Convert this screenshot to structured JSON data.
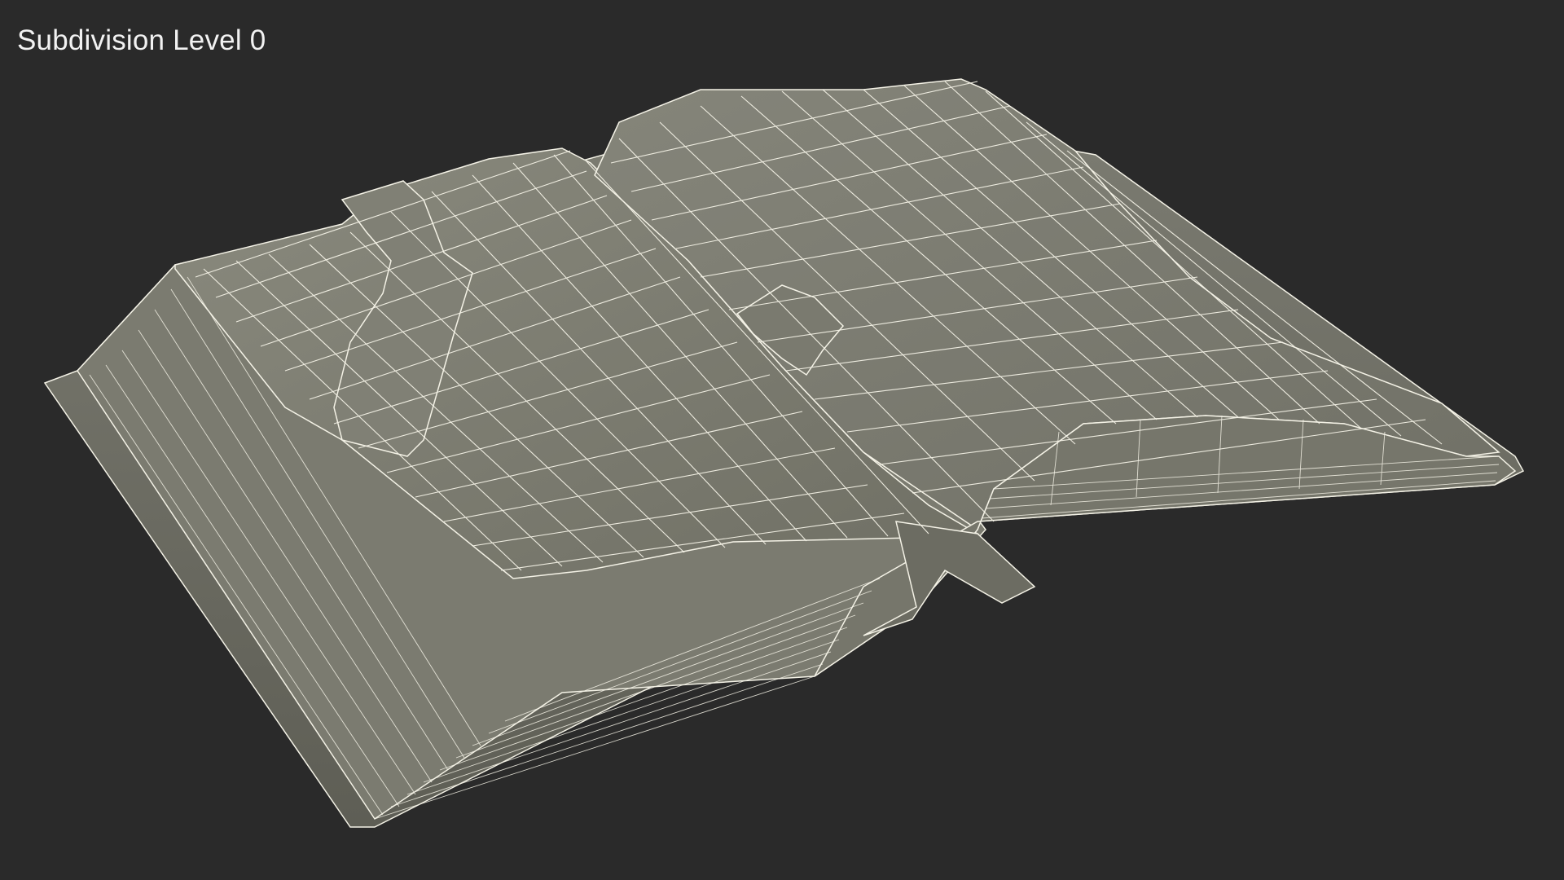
{
  "viewport": {
    "subdivision_label": "Subdivision Level 0",
    "background_color": "#2a2a2a"
  },
  "model": {
    "icon": "open-book-wireframe",
    "surface_color": "#7e7e72",
    "wire_color": "#f4f2e6"
  }
}
